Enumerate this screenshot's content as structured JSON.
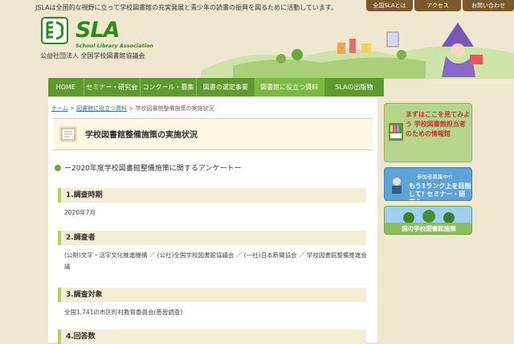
{
  "header": {
    "tagline": "JSLAは全国的な視野に立って学校図書館の充実発展と青少年の読書の振興を図るために活動しています。",
    "top_links": [
      "全国SLAとは",
      "アクセス",
      "お問い合わせ"
    ],
    "logo_word": "SLA",
    "logo_en": "School Library Association",
    "logo_jp": "公益社団法人 全国学校図書館協議会"
  },
  "nav": {
    "items": [
      "HOME",
      "セミナー・研究会",
      "コンクール・募集",
      "図書の選定事業",
      "図書館に役立つ資料",
      "SLAの出版物"
    ],
    "active_index": 4
  },
  "breadcrumb": {
    "home": "ホーム",
    "sep": ">",
    "parent": "図書館に役立つ資料",
    "current": "学校図書館整備施策の実施状況"
  },
  "page": {
    "title": "学校図書館整備施策の実施状況",
    "subheading": "ー2020年度学校図書館整備施策に関するアンケートー",
    "sections": [
      {
        "heading": "1.調査時期",
        "body": "2020年7月"
      },
      {
        "heading": "2.調査者",
        "body": "(公財)文字・活字文化推進機構 ／ (公社)全国学校図書館協議会 ／ (一社)日本新聞協会 ／ 学校図書館整備推進会議"
      },
      {
        "heading": "3.調査対象",
        "body": "全国1,741の市区町村教育委員会(悉皆調査)"
      },
      {
        "heading": "4.回答数",
        "body": ""
      }
    ]
  },
  "sidebar": {
    "banner1": "まずはここを見てみよう 学校図書館担当者のための情報館",
    "banner2_small": "参加者募集中!!",
    "banner2": "もう1ランク上を目指して! セミナー・研究会",
    "banner3": "国の学校図書館施策"
  },
  "colors": {
    "nav_green": "#5f9a2e",
    "nav_active": "#7bb842",
    "accent_brown": "#7a5a2c",
    "section_border": "#b7cf5e"
  }
}
